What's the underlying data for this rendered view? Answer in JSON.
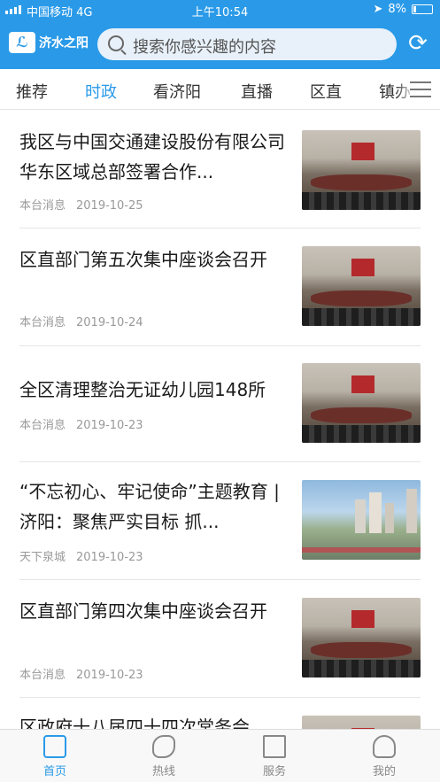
{
  "status_bar": {
    "carrier": "中国移动 4G",
    "time": "上午10:54",
    "battery": "8%"
  },
  "header": {
    "logo_text": "济水之阳",
    "search_placeholder": "搜索你感兴趣的内容"
  },
  "tabs": [
    {
      "label": "推荐",
      "active": false
    },
    {
      "label": "时政",
      "active": true
    },
    {
      "label": "看济阳",
      "active": false
    },
    {
      "label": "直播",
      "active": false
    },
    {
      "label": "区直",
      "active": false
    },
    {
      "label": "镇办",
      "active": false
    }
  ],
  "news": [
    {
      "title": "我区与中国交通建设股份有限公司华东区域总部签署合作...",
      "source": "本台消息",
      "date": "2019-10-25"
    },
    {
      "title": "区直部门第五次集中座谈会召开",
      "source": "本台消息",
      "date": "2019-10-24"
    },
    {
      "title": "全区清理整治无证幼儿园148所",
      "source": "本台消息",
      "date": "2019-10-23"
    },
    {
      "title": "“不忘初心、牢记使命”主题教育 | 济阳：聚焦严实目标 抓...",
      "source": "天下泉城",
      "date": "2019-10-23"
    },
    {
      "title": "区直部门第四次集中座谈会召开",
      "source": "本台消息",
      "date": "2019-10-23"
    },
    {
      "title": "区政府十八届四十四次常务会",
      "source": "",
      "date": ""
    }
  ],
  "bottom_nav": [
    {
      "label": "首页",
      "active": true
    },
    {
      "label": "热线",
      "active": false
    },
    {
      "label": "服务",
      "active": false
    },
    {
      "label": "我的",
      "active": false
    }
  ],
  "colors": {
    "accent": "#2a9ae8",
    "text": "#1a1a1a",
    "meta": "#999999"
  }
}
